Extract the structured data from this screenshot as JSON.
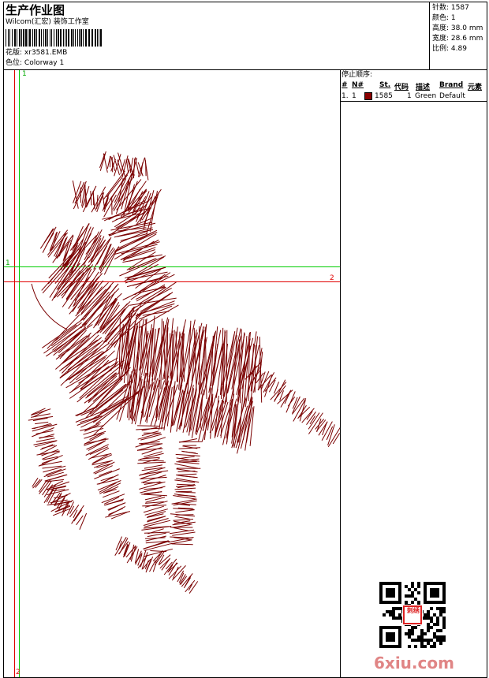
{
  "header": {
    "title": "生产作业图",
    "company": "Wilcom(汇宏) 装饰工作室",
    "design_label": "花版:",
    "design_value": "xr3581.EMB",
    "colorway_label": "色位:",
    "colorway_value": "Colorway 1"
  },
  "stats": [
    {
      "label": "针数:",
      "value": "1587"
    },
    {
      "label": "颜色:",
      "value": "1"
    },
    {
      "label": "高度:",
      "value": "38.0 mm"
    },
    {
      "label": "宽度:",
      "value": "28.6 mm"
    },
    {
      "label": "比例:",
      "value": "4.89"
    }
  ],
  "stop_sequence": {
    "title": "停止顺序:",
    "columns": [
      "#",
      "N#",
      "St.",
      "代码",
      "描述",
      "Brand",
      "元素"
    ],
    "rows": [
      {
        "index": "1.",
        "n": "1",
        "color": "#8b0000",
        "stitches": "1585",
        "code": "1",
        "description": "Green",
        "brand": "Default",
        "element": ""
      }
    ]
  },
  "guides": {
    "green_label_top": "1",
    "green_label_left": "1",
    "red_label_right": "2",
    "red_label_bottom": "2"
  },
  "artwork": {
    "thread_color": "#7a0000",
    "guide_green": "#00cc00",
    "guide_red": "#e00000"
  },
  "watermark": {
    "site": "6xiu.com",
    "stamp": "刺绣"
  }
}
